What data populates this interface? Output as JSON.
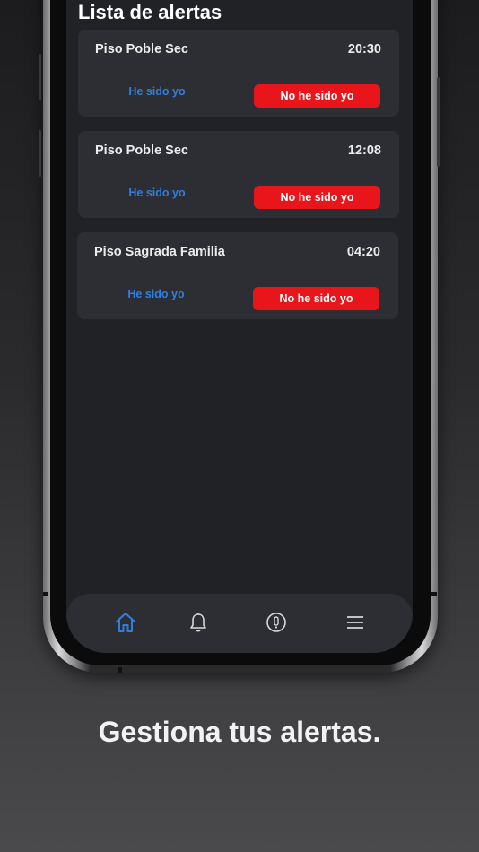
{
  "screen": {
    "title": "Lista de alertas"
  },
  "alerts": [
    {
      "name": "Piso Poble Sec",
      "time": "20:30",
      "yes_label": "He sido yo",
      "no_label": "No he sido yo"
    },
    {
      "name": "Piso Poble Sec",
      "time": "12:08",
      "yes_label": "He sido yo",
      "no_label": "No he sido yo"
    },
    {
      "name": "Piso Sagrada Familia",
      "time": "04:20",
      "yes_label": "He sido yo",
      "no_label": "No he sido yo"
    }
  ],
  "tabbar": {
    "items": [
      {
        "icon": "home-icon",
        "active": true
      },
      {
        "icon": "bell-icon",
        "active": false
      },
      {
        "icon": "info-circle-icon",
        "active": false
      },
      {
        "icon": "menu-icon",
        "active": false
      }
    ]
  },
  "colors": {
    "accent_blue": "#2f7fde",
    "danger_red": "#e8161b",
    "card_bg": "#2d2e33",
    "screen_bg": "#212225"
  },
  "tagline": "Gestiona tus alertas."
}
